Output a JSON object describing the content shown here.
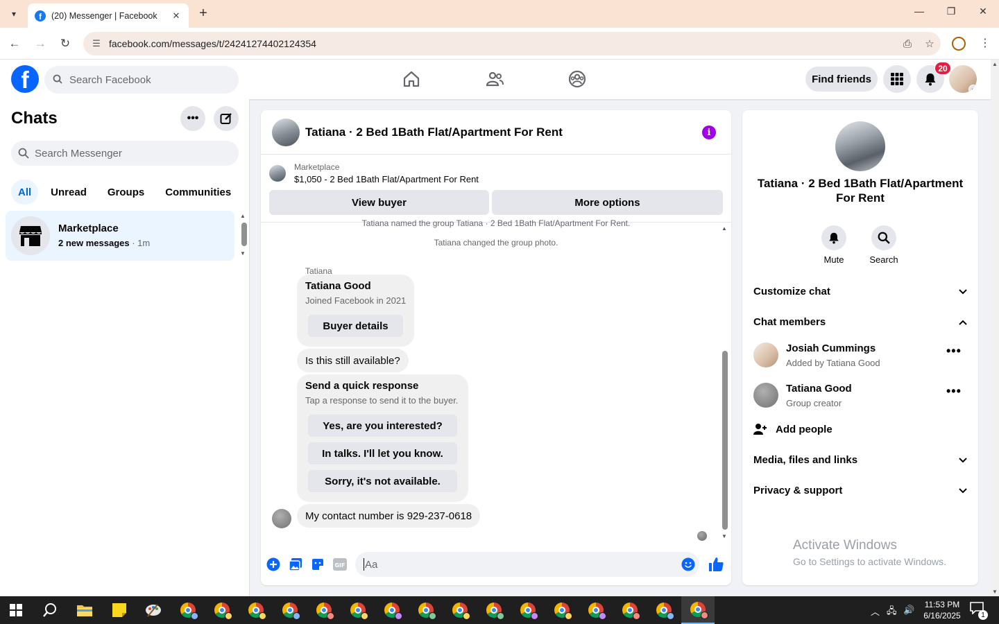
{
  "browser": {
    "tab_title": "(20) Messenger | Facebook",
    "url": "facebook.com/messages/t/24241274402124354"
  },
  "header": {
    "search_placeholder": "Search Facebook",
    "find_friends": "Find friends",
    "notifications_count": "20"
  },
  "chats": {
    "title": "Chats",
    "search_placeholder": "Search Messenger",
    "filters": [
      "All",
      "Unread",
      "Groups",
      "Communities"
    ],
    "items": [
      {
        "name": "Marketplace",
        "preview": "2 new messages",
        "time": " · 1m"
      }
    ]
  },
  "conversation": {
    "title": "Tatiana · 2 Bed 1Bath Flat/Apartment For Rent",
    "marketplace_label": "Marketplace",
    "listing": "$1,050 - 2 Bed 1Bath Flat/Apartment For Rent",
    "view_buyer": "View buyer",
    "more_options": "More options",
    "system_messages": [
      "Tatiana named the group Tatiana · 2 Bed 1Bath Flat/Apartment For Rent.",
      "Tatiana changed the group photo."
    ],
    "sender": "Tatiana",
    "buyer_card": {
      "name": "Tatiana Good",
      "joined": "Joined Facebook in 2021",
      "button": "Buyer details"
    },
    "question": "Is this still available?",
    "quick_response": {
      "title": "Send a quick response",
      "subtitle": "Tap a response to send it to the buyer.",
      "options": [
        "Yes, are you interested?",
        "In talks. I'll let you know.",
        "Sorry, it's not available."
      ]
    },
    "last_message": "My contact number is 929-237-0618",
    "composer_placeholder": "Aa"
  },
  "details": {
    "title": "Tatiana · 2 Bed 1Bath Flat/Apartment For Rent",
    "mute": "Mute",
    "search": "Search",
    "customize_chat": "Customize chat",
    "chat_members": "Chat members",
    "members": [
      {
        "name": "Josiah Cummings",
        "role": "Added by Tatiana Good"
      },
      {
        "name": "Tatiana Good",
        "role": "Group creator"
      }
    ],
    "add_people": "Add people",
    "media": "Media, files and links",
    "privacy": "Privacy & support"
  },
  "watermark": {
    "line1": "Activate Windows",
    "line2": "Go to Settings to activate Windows."
  },
  "taskbar": {
    "time": "11:53 PM",
    "date": "6/16/2025",
    "notifications": "1"
  },
  "colors": {
    "accent": "#0866ff",
    "info": "#a100e6",
    "badge": "#e41e3f"
  }
}
